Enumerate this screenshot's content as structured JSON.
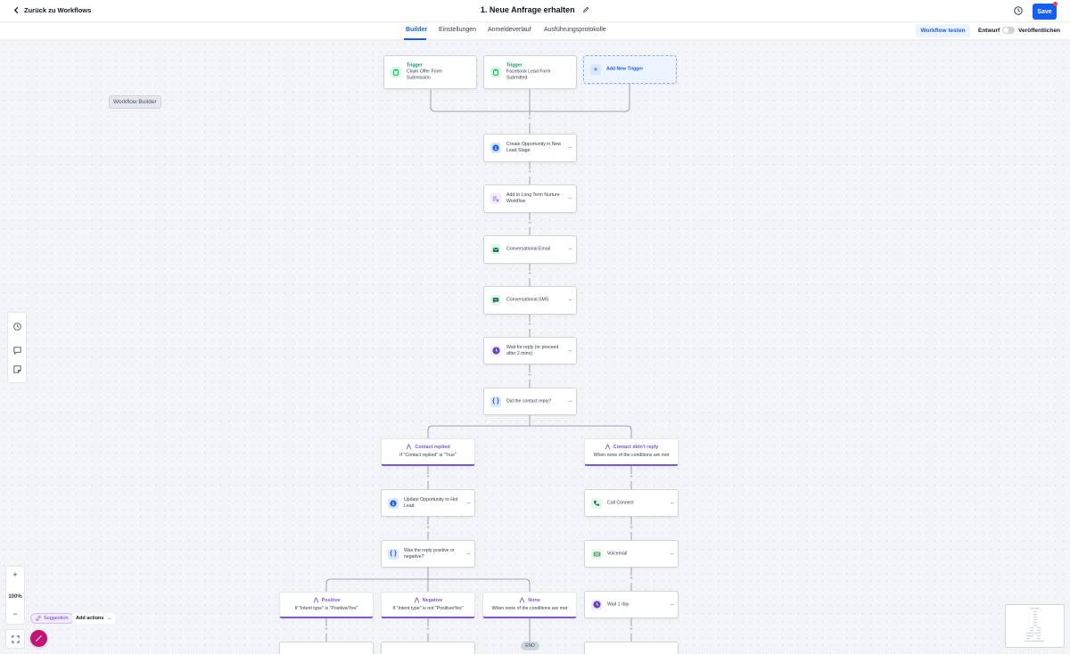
{
  "header": {
    "back_label": "Zurück zu Workflows",
    "title": "1. Neue Anfrage erhalten",
    "save_label": "Save"
  },
  "tabs": [
    {
      "label": "Builder",
      "active": true
    },
    {
      "label": "Einstellungen",
      "active": false
    },
    {
      "label": "Anmeldeverlauf",
      "active": false
    },
    {
      "label": "Ausführungsprotokolle",
      "active": false
    }
  ],
  "toolbar": {
    "test_label": "Workflow testen",
    "draft_label": "Entwurf",
    "publish_label": "Veröffentlichen",
    "published": false
  },
  "canvas": {
    "builder_label": "Workflow Builder",
    "zoom": "100%",
    "suggestion_label": "Suggestion",
    "add_actions_label": "Add actions",
    "end_label": "END"
  },
  "triggers": [
    {
      "kind": "Trigger",
      "name": "Claim Offer Form Submission",
      "icon": "clipboard-icon"
    },
    {
      "kind": "Trigger",
      "name": "Facebook Lead Form Submitted",
      "icon": "clipboard-icon"
    }
  ],
  "add_trigger_label": "Add New Trigger",
  "actions": [
    {
      "label": "Create Opportunity in New Lead Stage",
      "icon": "dollar-icon"
    },
    {
      "label": "Add to Long Term Nurture Workflow",
      "icon": "list-add-icon"
    },
    {
      "label": "Conversational Email",
      "icon": "email-icon"
    },
    {
      "label": "Conversational SMS",
      "icon": "sms-icon"
    },
    {
      "label": "Wait for reply (or proceed after 2 mins)",
      "icon": "clock-icon"
    },
    {
      "label": "Did the contact reply?",
      "icon": "braces-icon"
    }
  ],
  "branches": [
    {
      "title": "Contact replied",
      "condition": "If \"Contact replied\" is \"True\""
    },
    {
      "title": "Contact didn't reply",
      "condition": "When none of the conditions are met"
    }
  ],
  "left_actions": [
    {
      "label": "Update Opportunity to Hot Lead",
      "icon": "dollar-icon"
    },
    {
      "label": "Was the reply positive or negative?",
      "icon": "braces-icon"
    }
  ],
  "right_actions": [
    {
      "label": "Call Connect",
      "icon": "phone-icon"
    },
    {
      "label": "Voicemail",
      "icon": "voicemail-icon"
    },
    {
      "label": "Wait 1 day",
      "icon": "clock-icon"
    }
  ],
  "sub_branches": [
    {
      "title": "Positive",
      "condition": "If \"Intent type\" is \"Positive/Yes\""
    },
    {
      "title": "Negative",
      "condition": "If \"Intent type\" is not \"Positive/Yes\""
    },
    {
      "title": "None",
      "condition": "When none of the conditions are met"
    }
  ],
  "colors": {
    "accent": "#155eef",
    "branch": "#7f56d9",
    "trigger": "#039855"
  }
}
